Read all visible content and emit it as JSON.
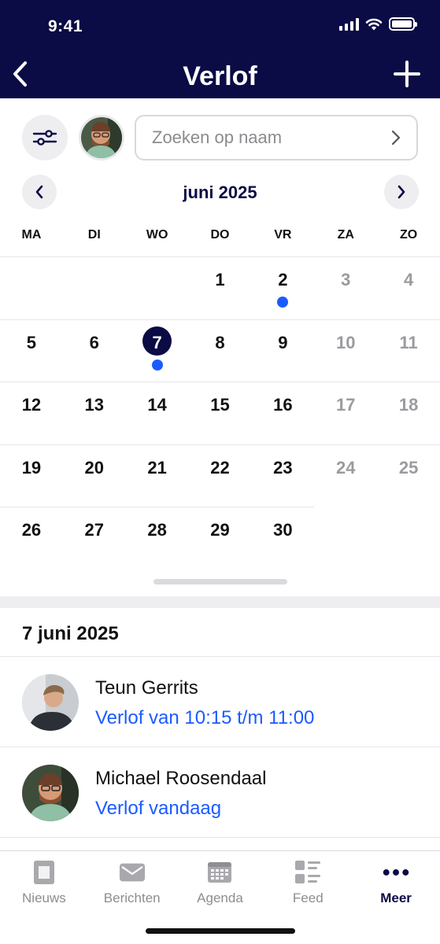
{
  "status_bar": {
    "time": "9:41"
  },
  "header": {
    "title": "Verlof",
    "back_icon": "chevron-left-icon",
    "add_icon": "plus-icon"
  },
  "toolbar": {
    "filter_icon": "sliders-icon",
    "search_placeholder": "Zoeken op naam",
    "search_chevron": "chevron-right-icon"
  },
  "calendar": {
    "month_label": "juni 2025",
    "weekdays": [
      "MA",
      "DI",
      "WO",
      "DO",
      "VR",
      "ZA",
      "ZO"
    ],
    "weeks": [
      [
        null,
        null,
        null,
        1,
        2,
        3,
        4
      ],
      [
        5,
        6,
        7,
        8,
        9,
        10,
        11
      ],
      [
        12,
        13,
        14,
        15,
        16,
        17,
        18
      ],
      [
        19,
        20,
        21,
        22,
        23,
        24,
        25
      ],
      [
        26,
        27,
        28,
        29,
        30,
        null,
        null
      ]
    ],
    "selected_day": 7,
    "event_days": [
      2,
      7
    ],
    "colors": {
      "accent": "#0b0b45",
      "event_dot": "#1a5bff",
      "weekend_text": "#9b9b9f"
    }
  },
  "selected_date_heading": "7 juni 2025",
  "leave_list": [
    {
      "name": "Teun Gerrits",
      "detail": "Verlof van 10:15 t/m 11:00"
    },
    {
      "name": "Michael Roosendaal",
      "detail": "Verlof vandaag"
    }
  ],
  "tabbar": {
    "tabs": [
      {
        "label": "Nieuws",
        "icon": "newspaper-icon"
      },
      {
        "label": "Berichten",
        "icon": "envelope-icon"
      },
      {
        "label": "Agenda",
        "icon": "calendar-icon"
      },
      {
        "label": "Feed",
        "icon": "feed-icon"
      },
      {
        "label": "Meer",
        "icon": "more-dots-icon"
      }
    ],
    "active": "Meer"
  }
}
